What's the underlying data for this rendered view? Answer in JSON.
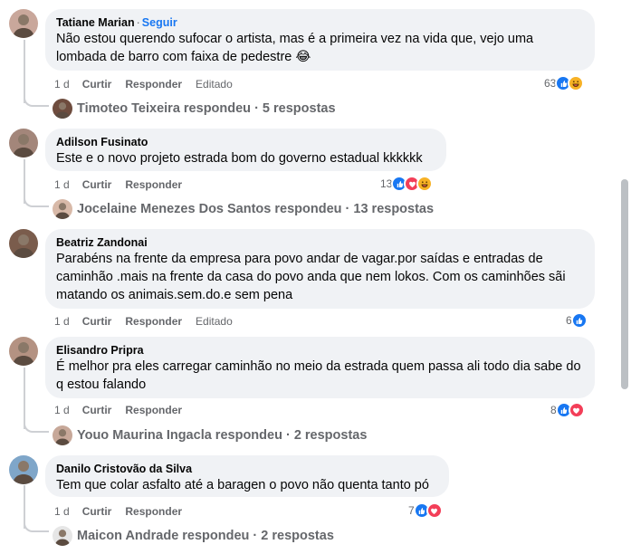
{
  "comments": [
    {
      "author": "Tatiane Marian",
      "follow_label": "Seguir",
      "text": "Não estou querendo sufocar o artista, mas é a primeira vez na vida que, vejo uma lombada de barro com faixa de pedestre 😂",
      "time": "1 d",
      "like_label": "Curtir",
      "reply_label": "Responder",
      "edited_label": "Editado",
      "reaction_count": "63",
      "reactions": [
        "like",
        "haha"
      ],
      "replies_text": "Timoteo Teixeira respondeu · 5 respostas"
    },
    {
      "author": "Adilson Fusinato",
      "text": "Este e o novo projeto estrada bom do governo estadual kkkkkk",
      "time": "1 d",
      "like_label": "Curtir",
      "reply_label": "Responder",
      "reaction_count": "13",
      "reactions": [
        "like",
        "love",
        "haha"
      ],
      "replies_text": "Jocelaine Menezes Dos Santos respondeu · 13 respostas"
    },
    {
      "author": "Beatriz Zandonai",
      "text": "Parabéns na frente da empresa para povo andar de vagar.por saídas e entradas de caminhão .mais na frente da casa do povo anda que nem lokos. Com os caminhões sãi matando os animais.sem.do.e sem pena",
      "time": "1 d",
      "like_label": "Curtir",
      "reply_label": "Responder",
      "edited_label": "Editado",
      "reaction_count": "6",
      "reactions": [
        "like"
      ]
    },
    {
      "author": "Elisandro Pripra",
      "text": "É melhor pra eles carregar caminhão no meio da estrada quem passa ali todo dia sabe do q estou falando",
      "time": "1 d",
      "like_label": "Curtir",
      "reply_label": "Responder",
      "reaction_count": "8",
      "reactions": [
        "like",
        "love"
      ],
      "replies_text": "Youo Maurina Ingacla respondeu · 2 respostas"
    },
    {
      "author": "Danilo Cristovão da Silva",
      "text": "Tem que colar asfalto até a baragen o povo não quenta tanto pó",
      "time": "1 d",
      "like_label": "Curtir",
      "reply_label": "Responder",
      "reaction_count": "7",
      "reactions": [
        "like",
        "love"
      ],
      "replies_text": "Maicon Andrade respondeu · 2 respostas"
    }
  ],
  "colors": {
    "bubble": "#f0f2f5",
    "like": "#1877f2",
    "love": "#f33e58",
    "haha": "#f7b125",
    "secondary_text": "#65676b"
  }
}
